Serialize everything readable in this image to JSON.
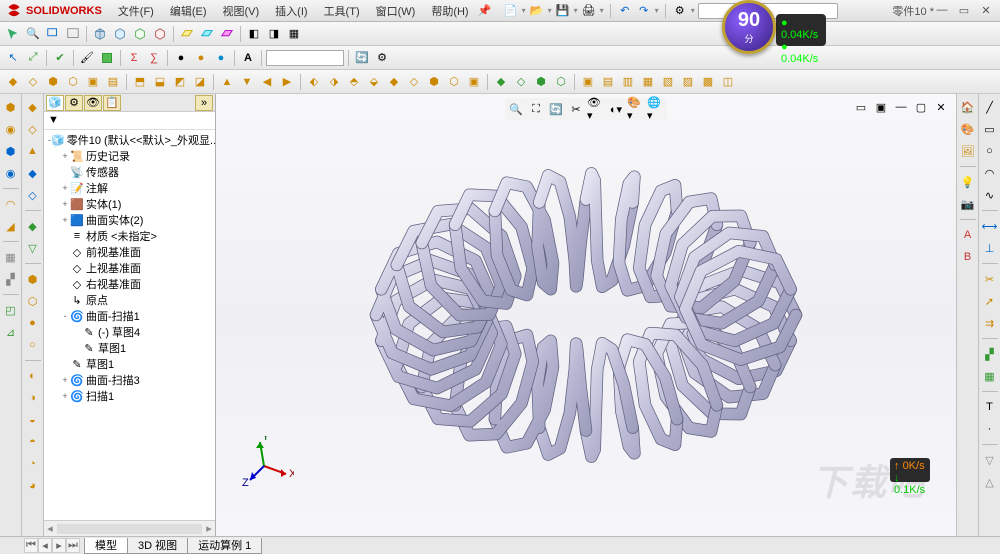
{
  "app": {
    "name": "SOLIDWORKS",
    "doc_title": "零件10 *"
  },
  "menu": [
    "文件(F)",
    "编辑(E)",
    "视图(V)",
    "插入(I)",
    "工具(T)",
    "窗口(W)",
    "帮助(H)"
  ],
  "score": {
    "value": "90",
    "unit": "分",
    "net_up": "0.04K/s",
    "net_down": "0.04K/s"
  },
  "tree": {
    "root": "零件10  (默认<<默认>_外观显...",
    "items": [
      {
        "indent": 1,
        "icon": "history-icon",
        "label": "历史记录",
        "twisty": "+"
      },
      {
        "indent": 1,
        "icon": "sensor-icon",
        "label": "传感器"
      },
      {
        "indent": 1,
        "icon": "note-icon",
        "label": "注解",
        "twisty": "+"
      },
      {
        "indent": 1,
        "icon": "solid-icon",
        "label": "实体(1)",
        "twisty": "+"
      },
      {
        "indent": 1,
        "icon": "surface-icon",
        "label": "曲面实体(2)",
        "twisty": "+"
      },
      {
        "indent": 1,
        "icon": "material-icon",
        "label": "材质 <未指定>"
      },
      {
        "indent": 1,
        "icon": "plane-icon",
        "label": "前视基准面"
      },
      {
        "indent": 1,
        "icon": "plane-icon",
        "label": "上视基准面"
      },
      {
        "indent": 1,
        "icon": "plane-icon",
        "label": "右视基准面"
      },
      {
        "indent": 1,
        "icon": "origin-icon",
        "label": "原点"
      },
      {
        "indent": 1,
        "icon": "sweep-icon",
        "label": "曲面-扫描1",
        "twisty": "-"
      },
      {
        "indent": 2,
        "icon": "sketch-icon",
        "label": "(-) 草图4"
      },
      {
        "indent": 2,
        "icon": "sketch-icon",
        "label": "草图1"
      },
      {
        "indent": 1,
        "icon": "sketch-icon",
        "label": "草图1"
      },
      {
        "indent": 1,
        "icon": "sweep-icon",
        "label": "曲面-扫描3",
        "twisty": "+"
      },
      {
        "indent": 1,
        "icon": "sweep-icon",
        "label": "扫描1",
        "twisty": "+"
      }
    ]
  },
  "bottom_tabs": [
    "模型",
    "3D 视图",
    "运动算例 1"
  ],
  "triad": {
    "x": "X",
    "y": "Y",
    "z": "Z"
  },
  "watermark": "下载吧",
  "stat": {
    "up": "0K/s",
    "down": "0.1K/s"
  }
}
